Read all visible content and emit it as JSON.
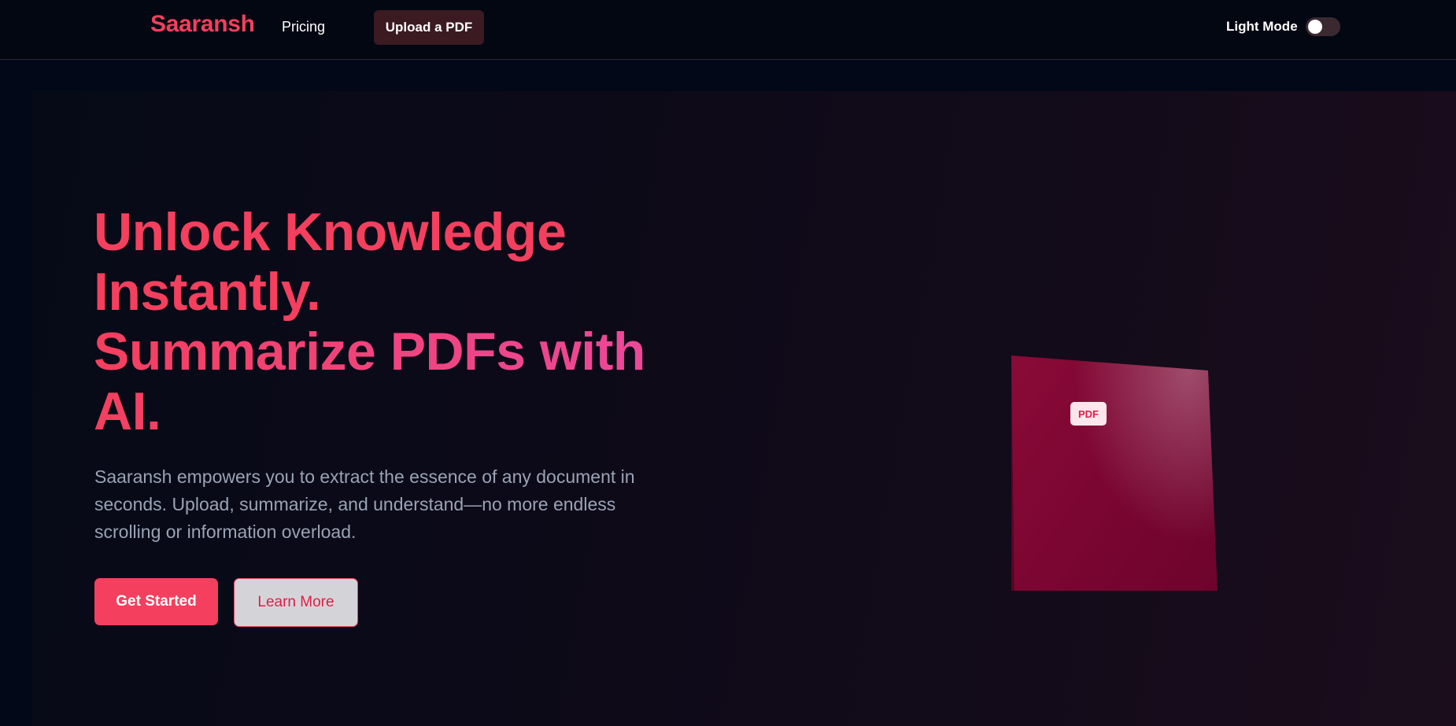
{
  "header": {
    "brand": "Saaransh",
    "nav": {
      "pricing": "Pricing"
    },
    "upload_label": "Upload a PDF",
    "theme_label": "Light Mode",
    "theme_toggle_on": false
  },
  "hero": {
    "headline_line1": "Unlock Knowledge",
    "headline_line2": "Instantly.",
    "headline_line3": "Summarize PDFs with",
    "headline_line4": "AI.",
    "description": "Saaransh empowers you to extract the essence of any document in seconds. Upload, summarize, and understand—no more endless scrolling or information overload.",
    "primary_cta": "Get Started",
    "secondary_cta": "Learn More",
    "pdf_badge": "PDF"
  },
  "colors": {
    "background": "#030712",
    "accent": "#f43f5e",
    "accent_pink": "#ec4899",
    "pdf_cover": "#7d0631",
    "upload_button_bg": "#3b1a22"
  }
}
